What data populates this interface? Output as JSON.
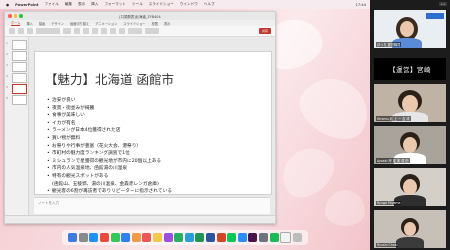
{
  "menubar": {
    "app_name": "PowerPoint",
    "items": [
      "ファイル",
      "編集",
      "表示",
      "挿入",
      "フォーマット",
      "ツール",
      "スライドショー",
      "ウインドウ",
      "ヘルプ"
    ],
    "clock": "17:44"
  },
  "window": {
    "title": "[口頭発表]北海道_ZYB404",
    "ribbon_tabs": [
      "ホーム",
      "挿入",
      "描画",
      "デザイン",
      "画面切り替え",
      "アニメーション",
      "スライドショー",
      "校閲",
      "表示"
    ],
    "active_tab": "ホーム",
    "share_label": "共有"
  },
  "slide": {
    "title": "【魅力】北海道 函館市",
    "bullets": [
      "治安が良い",
      "夜景・街並みが綺麗",
      "食事が美味しい",
      "イカが有名",
      "ラーメンが日本4位獲得された店",
      "買い物が無料",
      "お祭りや行事が豊富（花火大会、港祭り）",
      "市町村の魅力度ランキング調査で1位",
      "ミシュランで星獲得の観光地が市内に20個以上ある",
      "市内の人気温泉地、函館湯の川温泉",
      "特有の観光スポットがある",
      "(函館山、五稜郭、湯の川温泉、金森赤レンガ倉庫)",
      "観光客の6割が再訪者でありリピーターに指示されている"
    ],
    "bullet_symbol": "•"
  },
  "notes": {
    "placeholder": "ノートを入力"
  },
  "slide_numbers": [
    "1",
    "2",
    "3",
    "4",
    "5",
    "6"
  ],
  "zoom": {
    "ops_label": "【運営】宮崎",
    "participants": [
      {
        "name": "ほっち 運営職員"
      },
      {
        "name": "Hiromu 北 上 一 吉 成"
      },
      {
        "name": "Ayaaki 岸 能 実 成 田"
      },
      {
        "name": "Ryugo Miyama"
      },
      {
        "name": "Ryushi Chaki"
      }
    ]
  }
}
